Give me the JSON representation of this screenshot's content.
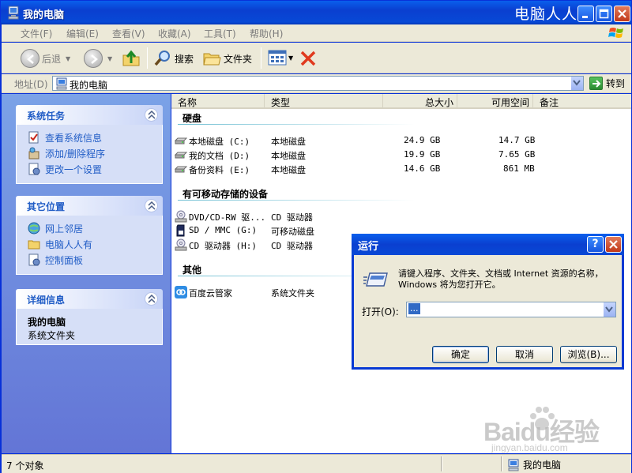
{
  "window": {
    "title": "我的电脑",
    "watermark_title": "电脑人人有"
  },
  "menu": [
    "文件(F)",
    "编辑(E)",
    "查看(V)",
    "收藏(A)",
    "工具(T)",
    "帮助(H)"
  ],
  "toolbar": {
    "back": "后退",
    "search": "搜索",
    "folders": "文件夹"
  },
  "address": {
    "label": "地址(D)",
    "value": "我的电脑",
    "go": "转到"
  },
  "tasks": {
    "system": {
      "title": "系统任务",
      "items": [
        "查看系统信息",
        "添加/删除程序",
        "更改一个设置"
      ]
    },
    "other": {
      "title": "其它位置",
      "items": [
        "网上邻居",
        "电脑人人有",
        "控制面板"
      ]
    },
    "details": {
      "title": "详细信息",
      "name": "我的电脑",
      "desc": "系统文件夹"
    }
  },
  "columns": [
    "名称",
    "类型",
    "总大小",
    "可用空间",
    "备注"
  ],
  "groups": {
    "hdd": {
      "title": "硬盘",
      "rows": [
        {
          "name": "本地磁盘 (C:)",
          "type": "本地磁盘",
          "total": "24.9 GB",
          "free": "14.7 GB"
        },
        {
          "name": "我的文档 (D:)",
          "type": "本地磁盘",
          "total": "19.9 GB",
          "free": "7.65 GB"
        },
        {
          "name": "备份资料 (E:)",
          "type": "本地磁盘",
          "total": "14.6 GB",
          "free": "861 MB"
        }
      ]
    },
    "removable": {
      "title": "有可移动存储的设备",
      "rows": [
        {
          "name": "DVD/CD-RW 驱...",
          "type": "CD 驱动器"
        },
        {
          "name": "SD / MMC (G:)",
          "type": "可移动磁盘"
        },
        {
          "name": "CD 驱动器 (H:)",
          "type": "CD 驱动器"
        }
      ]
    },
    "other": {
      "title": "其他",
      "rows": [
        {
          "name": "百度云管家",
          "type": "系统文件夹"
        }
      ]
    }
  },
  "status": {
    "count": "7 个对象",
    "location": "我的电脑"
  },
  "run_dialog": {
    "title": "运行",
    "help": "?",
    "description": "请键入程序、文件夹、文档或 Internet 资源的名称，Windows 将为您打开它。",
    "open_label": "打开(O):",
    "open_value": "...",
    "ok": "确定",
    "cancel": "取消",
    "browse": "浏览(B)..."
  },
  "watermark": {
    "brand": "Baidu经验",
    "url": "jingyan.baidu.com"
  }
}
